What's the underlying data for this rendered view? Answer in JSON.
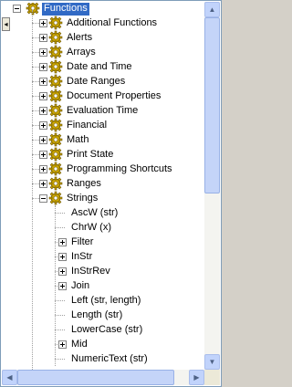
{
  "tree": {
    "root": {
      "label": "Functions",
      "icon": "gear-icon",
      "expanded": true,
      "selected": true
    },
    "categories": [
      {
        "label": "Additional Functions",
        "icon": "gear-icon",
        "expanded": false
      },
      {
        "label": "Alerts",
        "icon": "gear-icon",
        "expanded": false
      },
      {
        "label": "Arrays",
        "icon": "gear-icon",
        "expanded": false
      },
      {
        "label": "Date and Time",
        "icon": "gear-icon",
        "expanded": false
      },
      {
        "label": "Date Ranges",
        "icon": "gear-icon",
        "expanded": false
      },
      {
        "label": "Document Properties",
        "icon": "gear-icon",
        "expanded": false
      },
      {
        "label": "Evaluation Time",
        "icon": "gear-icon",
        "expanded": false
      },
      {
        "label": "Financial",
        "icon": "gear-icon",
        "expanded": false
      },
      {
        "label": "Math",
        "icon": "gear-icon",
        "expanded": false
      },
      {
        "label": "Print State",
        "icon": "gear-icon",
        "expanded": false
      },
      {
        "label": "Programming Shortcuts",
        "icon": "gear-icon",
        "expanded": false
      },
      {
        "label": "Ranges",
        "icon": "gear-icon",
        "expanded": false
      },
      {
        "label": "Strings",
        "icon": "gear-icon",
        "expanded": true
      }
    ],
    "string_functions": [
      {
        "label": "AscW (str)",
        "has_children": false
      },
      {
        "label": "ChrW (x)",
        "has_children": false
      },
      {
        "label": "Filter",
        "has_children": true
      },
      {
        "label": "InStr",
        "has_children": true
      },
      {
        "label": "InStrRev",
        "has_children": true
      },
      {
        "label": "Join",
        "has_children": true
      },
      {
        "label": "Left (str, length)",
        "has_children": false
      },
      {
        "label": "Length (str)",
        "has_children": false
      },
      {
        "label": "LowerCase (str)",
        "has_children": false
      },
      {
        "label": "Mid",
        "has_children": true
      },
      {
        "label": "NumericText (str)",
        "has_children": false
      }
    ]
  },
  "colors": {
    "selection": "#316ac5",
    "gear": "#c9a400"
  }
}
